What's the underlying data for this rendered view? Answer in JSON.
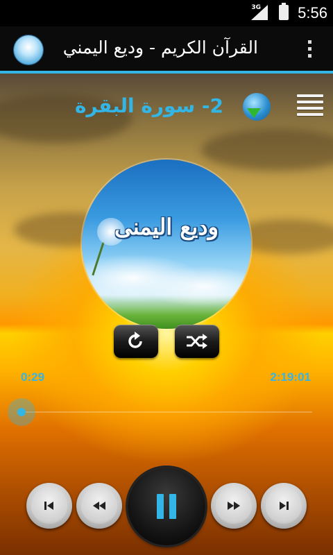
{
  "status_bar": {
    "network": "3G",
    "time": "5:56"
  },
  "action_bar": {
    "title": "القرآن الكريم - وديع اليمني",
    "icons": {
      "app": "app-logo-icon",
      "overflow": "overflow-menu-icon"
    }
  },
  "player": {
    "surah_title": "2- سورة البقرة",
    "album_art_text": "وديع اليمنى",
    "icons": {
      "download": "globe-download-icon",
      "playlist": "menu-icon",
      "repeat": "repeat-icon",
      "shuffle": "shuffle-icon",
      "skip_previous": "skip-previous-icon",
      "rewind": "rewind-icon",
      "pause": "pause-icon",
      "fast_forward": "fast-forward-icon",
      "skip_next": "skip-next-icon"
    },
    "elapsed": "0:29",
    "duration": "2:19:01",
    "progress": 0.0035
  },
  "colors": {
    "accent": "#33b5e5"
  }
}
